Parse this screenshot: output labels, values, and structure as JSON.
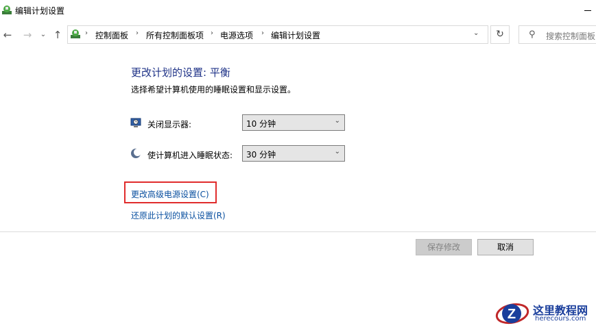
{
  "window": {
    "title": "编辑计划设置"
  },
  "nav": {
    "back_icon": "←",
    "forward_icon": "→",
    "recent_icon": "⌄",
    "up_icon": "↑",
    "breadcrumb": [
      "控制面板",
      "所有控制面板项",
      "电源选项",
      "编辑计划设置"
    ],
    "separator": "›",
    "dropdown_icon": "⌄",
    "refresh_icon": "↻",
    "search_icon": "⚲",
    "search_placeholder": "搜索控制面板"
  },
  "main": {
    "title": "更改计划的设置: 平衡",
    "subtitle": "选择希望计算机使用的睡眠设置和显示设置。",
    "settings": [
      {
        "label": "关闭显示器:",
        "value": "10 分钟",
        "icon": "monitor-clock-icon"
      },
      {
        "label": "使计算机进入睡眠状态:",
        "value": "30 分钟",
        "icon": "moon-icon"
      }
    ],
    "advanced_link": "更改高级电源设置(C)",
    "restore_link": "还原此计划的默认设置(R)",
    "highlight_color": "#e02b2b"
  },
  "footer": {
    "save_label": "保存修改",
    "cancel_label": "取消"
  },
  "watermark": {
    "text": "这里教程网",
    "url": "herecours.com",
    "letter": "Z"
  }
}
